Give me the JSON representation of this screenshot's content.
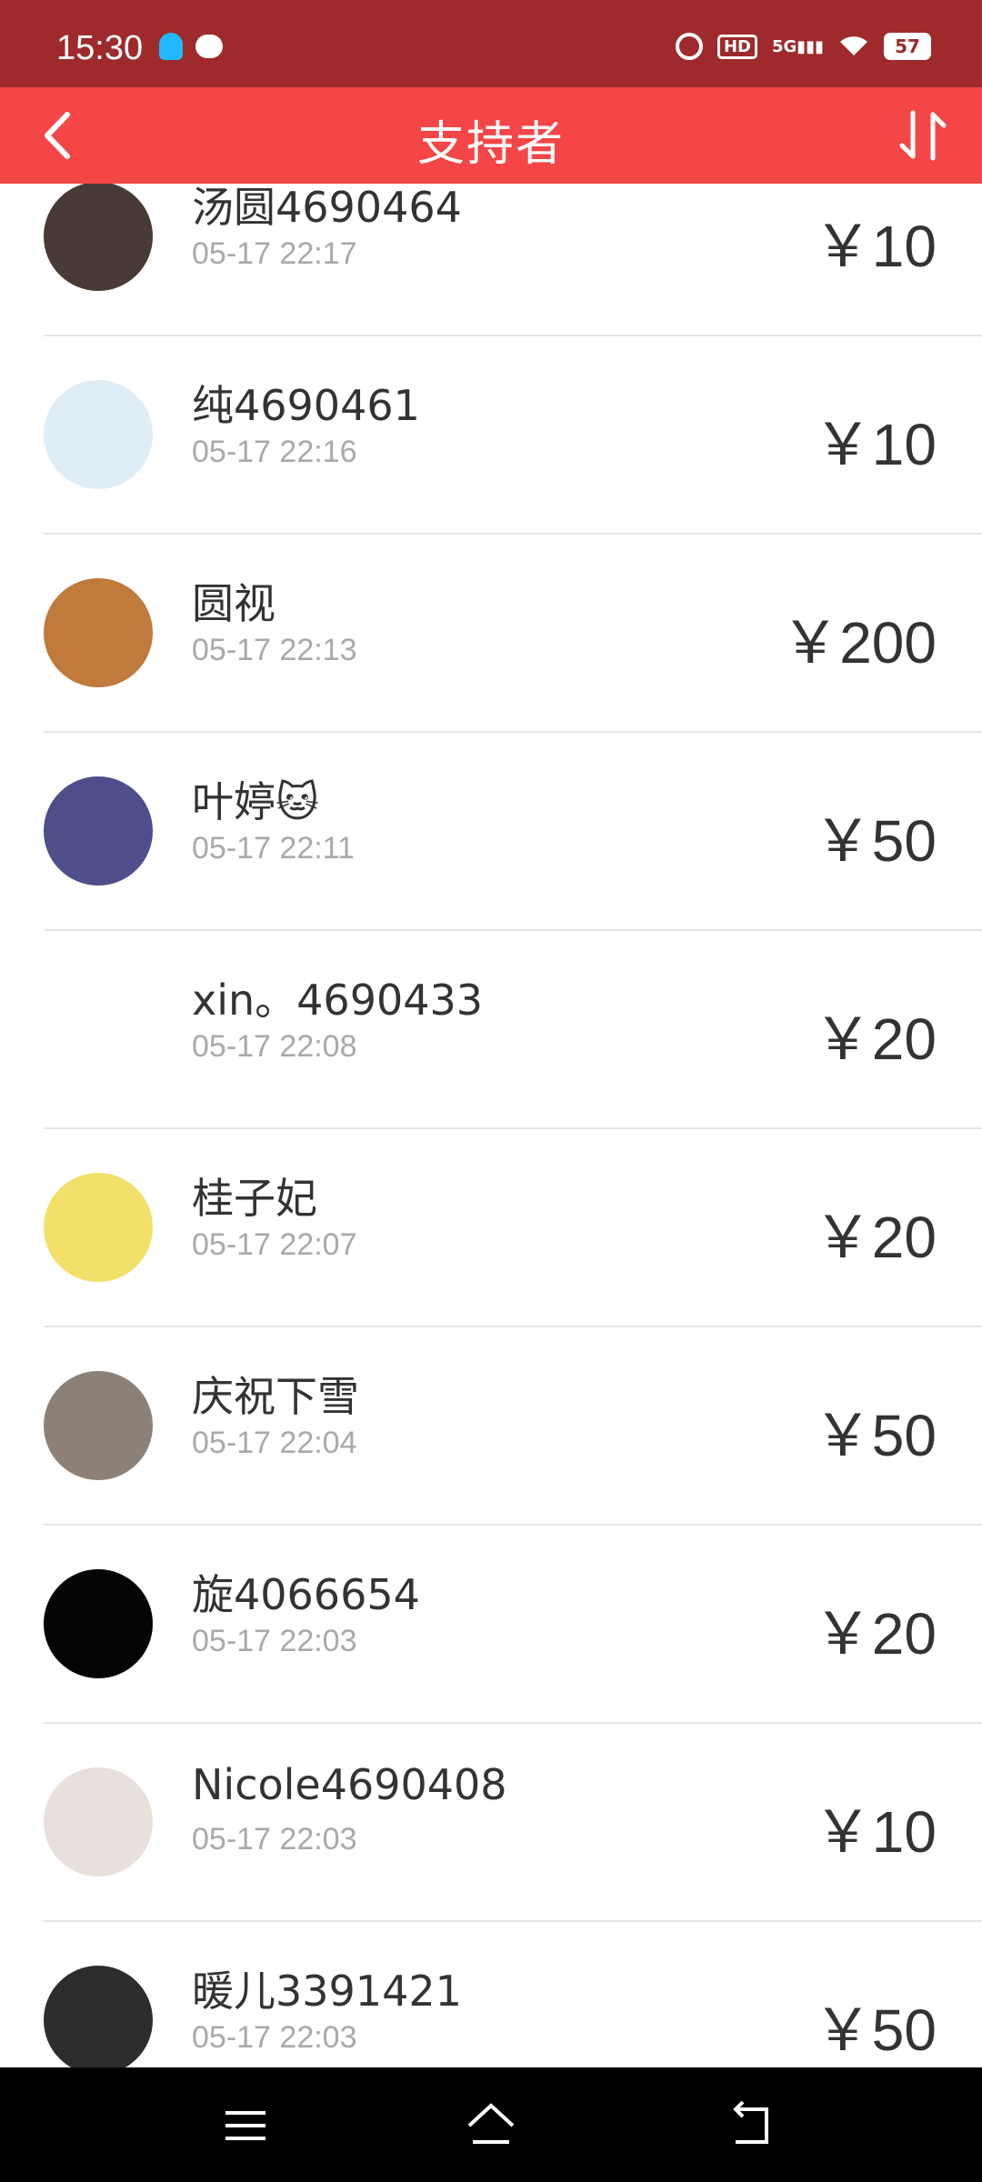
{
  "status_bar": {
    "time": "15:30",
    "battery": "57"
  },
  "header": {
    "title": "支持者"
  },
  "supporters": [
    {
      "name": "汤圆4690464",
      "time": "05-17 22:17",
      "amount": "￥10",
      "avatar_color": "#4a3a35"
    },
    {
      "name": "纯4690461",
      "time": "05-17 22:16",
      "amount": "￥10",
      "avatar_color": "#dfeef6"
    },
    {
      "name": "圆视",
      "time": "05-17 22:13",
      "amount": "￥200",
      "avatar_color": "#c07a3c"
    },
    {
      "name": "叶婷🐱",
      "time": "05-17 22:11",
      "amount": "￥50",
      "avatar_color": "#4d4e8a"
    },
    {
      "name": "xin。4690433",
      "time": "05-17 22:08",
      "amount": "￥20",
      "avatar_color": "#ffffff"
    },
    {
      "name": "桂子妃",
      "time": "05-17 22:07",
      "amount": "￥20",
      "avatar_color": "#f3e06a"
    },
    {
      "name": "庆祝下雪",
      "time": "05-17 22:04",
      "amount": "￥50",
      "avatar_color": "#8d8177"
    },
    {
      "name": "旋4066654",
      "time": "05-17 22:03",
      "amount": "￥20",
      "avatar_color": "#050505"
    },
    {
      "name": "Nicole4690408",
      "time": "05-17 22:03",
      "amount": "￥10",
      "avatar_color": "#e8e0dc"
    },
    {
      "name": "暖儿3391421",
      "time": "05-17 22:03",
      "amount": "￥50",
      "avatar_color": "#2d2d2d"
    }
  ]
}
